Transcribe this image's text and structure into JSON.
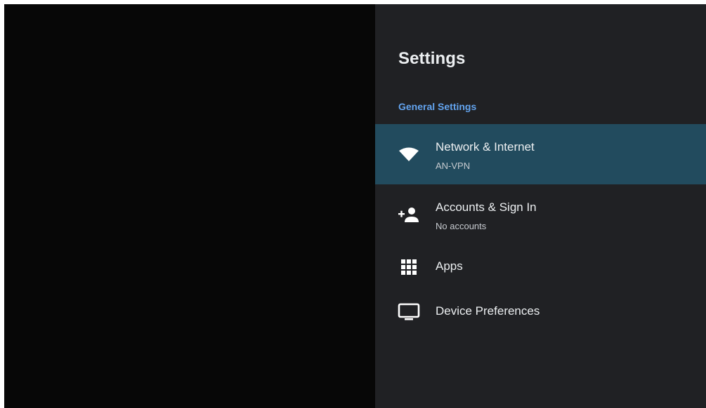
{
  "settings": {
    "title": "Settings",
    "section_label": "General Settings",
    "items": [
      {
        "label": "Network & Internet",
        "sublabel": "AN-VPN",
        "icon": "wifi-icon",
        "selected": true
      },
      {
        "label": "Accounts & Sign In",
        "sublabel": "No accounts",
        "icon": "add-person-icon",
        "selected": false
      },
      {
        "label": "Apps",
        "icon": "apps-grid-icon",
        "selected": false
      },
      {
        "label": "Device Preferences",
        "icon": "tv-monitor-icon",
        "selected": false
      }
    ]
  },
  "colors": {
    "panel_background": "#202124",
    "selected_item": "#224b5e",
    "section_label": "#63a4ef",
    "content_background": "#070707"
  }
}
